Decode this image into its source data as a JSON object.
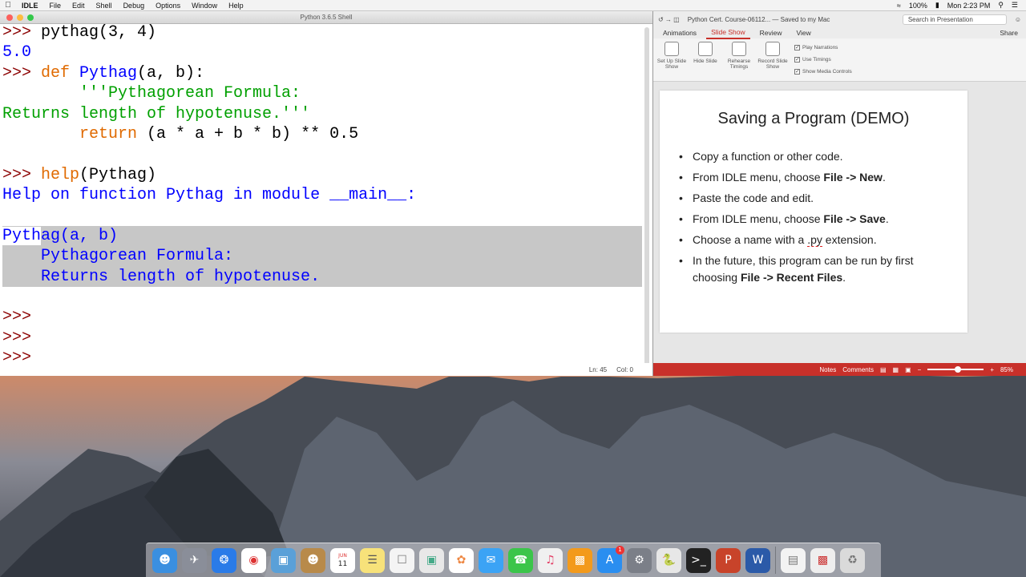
{
  "menubar": {
    "app": "IDLE",
    "items": [
      "File",
      "Edit",
      "Shell",
      "Debug",
      "Options",
      "Window",
      "Help"
    ],
    "battery": "100%",
    "clock": "Mon 2:23 PM"
  },
  "idle": {
    "title": "Python 3.6.5 Shell",
    "status": {
      "line": "Ln: 45",
      "col": "Col: 0"
    },
    "lines": [
      [
        {
          "t": ">>> ",
          "c": "pr"
        },
        {
          "t": "pythag(3, 4)",
          "c": ""
        }
      ],
      [
        {
          "t": "5.0",
          "c": "out"
        }
      ],
      [
        {
          "t": ">>> ",
          "c": "pr"
        },
        {
          "t": "def ",
          "c": "kw"
        },
        {
          "t": "Pythag",
          "c": "fn"
        },
        {
          "t": "(a, b):",
          "c": ""
        }
      ],
      [
        {
          "t": "        '''Pythagorean Formula:",
          "c": "str"
        }
      ],
      [
        {
          "t": "Returns length of hypotenuse.'''",
          "c": "str"
        }
      ],
      [
        {
          "t": "        ",
          "c": ""
        },
        {
          "t": "return",
          "c": "kw"
        },
        {
          "t": " (a * a + b * b) ** 0.5",
          "c": ""
        }
      ],
      [
        {
          "t": "",
          "c": ""
        }
      ],
      [
        {
          "t": ">>> ",
          "c": "pr"
        },
        {
          "t": "help",
          "c": "kw"
        },
        {
          "t": "(Pythag)",
          "c": ""
        }
      ],
      [
        {
          "t": "Help on function Pythag in module __main__:",
          "c": "out"
        }
      ],
      [
        {
          "t": "",
          "c": ""
        }
      ],
      [
        {
          "t": "Pyth",
          "c": "out"
        },
        {
          "t": "ag(a, b)",
          "c": "out"
        }
      ],
      [
        {
          "t": "    Pythagorean Formula:",
          "c": "out"
        }
      ],
      [
        {
          "t": "    Returns length of hypotenuse.",
          "c": "out"
        }
      ],
      [
        {
          "t": "",
          "c": ""
        }
      ],
      [
        {
          "t": ">>>",
          "c": "pr"
        }
      ],
      [
        {
          "t": ">>>",
          "c": "pr"
        }
      ],
      [
        {
          "t": ">>>",
          "c": "pr"
        }
      ]
    ],
    "selected_lines": [
      10,
      11,
      12
    ]
  },
  "ppt": {
    "title": "Python Cert. Course-06112...  — Saved to my Mac",
    "search": "Search in Presentation",
    "tabs": [
      "Animations",
      "Slide Show",
      "Review",
      "View"
    ],
    "active_tab": "Slide Show",
    "share": "Share",
    "ribbon": {
      "buttons": [
        "Set Up Slide Show",
        "Hide Slide",
        "Rehearse Timings",
        "Record Slide Show"
      ],
      "checks": [
        "Play Narrations",
        "Use Timings",
        "Show Media Controls"
      ]
    },
    "slide": {
      "title": "Saving a Program (DEMO)",
      "bullets": [
        [
          {
            "t": "Copy a function or other code."
          }
        ],
        [
          {
            "t": "From IDLE menu, choose "
          },
          {
            "t": "File -> New",
            "b": true
          },
          {
            "t": "."
          }
        ],
        [
          {
            "t": "Paste the code and edit."
          }
        ],
        [
          {
            "t": "From IDLE menu, choose "
          },
          {
            "t": "File -> Save",
            "b": true
          },
          {
            "t": "."
          }
        ],
        [
          {
            "t": "Choose a name with a "
          },
          {
            "t": ".py",
            "u": true
          },
          {
            "t": " extension."
          }
        ],
        [
          {
            "t": "In the future, this program can be run by first choosing "
          },
          {
            "t": "File -> Recent Files",
            "b": true
          },
          {
            "t": "."
          }
        ]
      ]
    },
    "status": {
      "notes": "Notes",
      "comments": "Comments",
      "zoom": "85%"
    }
  },
  "dock": {
    "calendar_month": "JUN",
    "calendar_day": "11",
    "badge": "1"
  }
}
